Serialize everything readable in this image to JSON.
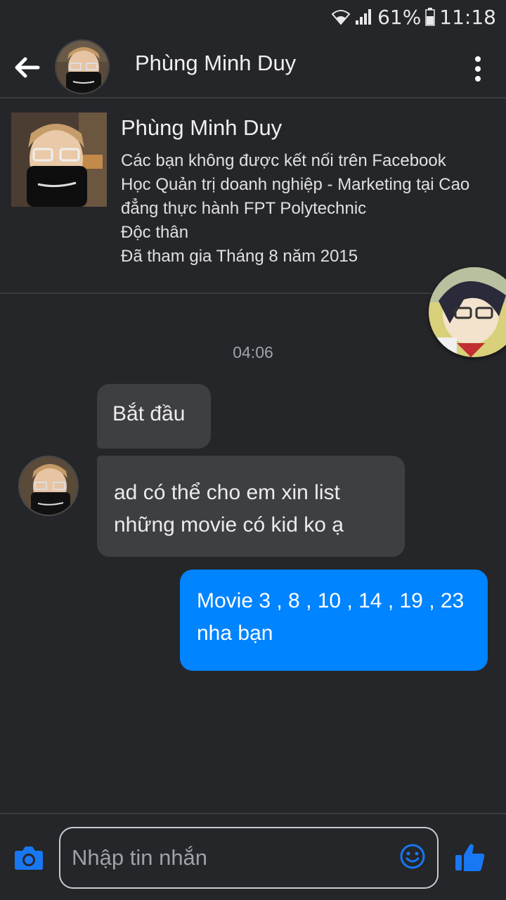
{
  "status_bar": {
    "battery_percent": "61%",
    "time": "11:18",
    "icons": [
      "wifi-icon",
      "signal-icon",
      "battery-icon"
    ]
  },
  "header": {
    "title": "Phùng Minh Duy",
    "back_icon": "arrow-left-icon",
    "menu_icon": "more-vertical-icon"
  },
  "profile": {
    "name": "Phùng Minh Duy",
    "connection": "Các bạn không được kết nối trên Facebook",
    "education": "Học Quản trị doanh nghiệp - Marketing tại Cao đẳng thực hành FPT Polytechnic",
    "relationship": "Độc thân",
    "joined": "Đã tham gia Tháng 8 năm 2015"
  },
  "conversation": {
    "timestamp": "04:06",
    "messages": [
      {
        "direction": "incoming",
        "text": "Bắt đầu"
      },
      {
        "direction": "incoming",
        "text": "ad có thể cho em xin list những movie có kid ko ạ"
      },
      {
        "direction": "outgoing",
        "text": "Movie 3 , 8 , 10 , 14 , 19 , 23 nha bạn"
      }
    ]
  },
  "composer": {
    "placeholder": "Nhập tin nhắn",
    "value": "",
    "icons": [
      "camera-icon",
      "emoji-icon",
      "thumbs-up-icon"
    ]
  },
  "colors": {
    "background": "#252629",
    "incoming_bubble": "#3e3f43",
    "outgoing_bubble": "#0084ff",
    "accent": "#1877f2"
  }
}
